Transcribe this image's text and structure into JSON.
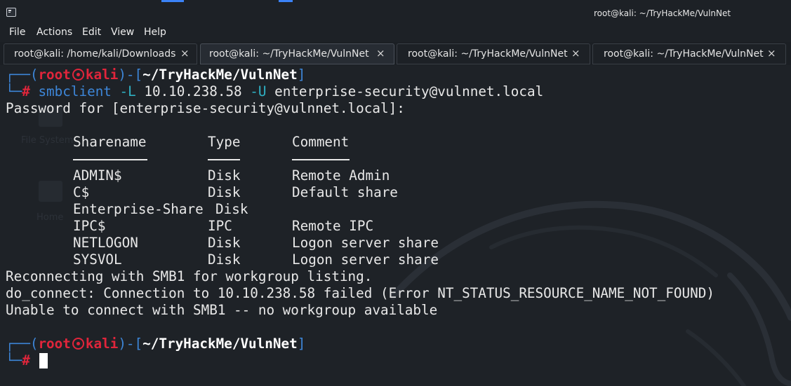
{
  "window": {
    "title": "root@kali: ~/TryHackMe/VulnNet",
    "app_icon": "terminal-icon"
  },
  "menu": {
    "items": [
      "File",
      "Actions",
      "Edit",
      "View",
      "Help"
    ]
  },
  "tabs": [
    {
      "label": "root@kali: /home/kali/Downloads",
      "close": "×",
      "active": false
    },
    {
      "label": "root@kali: ~/TryHackMe/VulnNet",
      "close": "×",
      "active": true
    },
    {
      "label": "root@kali: ~/TryHackMe/VulnNet",
      "close": "×",
      "active": false
    },
    {
      "label": "root@kali: ~/TryHackMe/VulnNet",
      "close": "×",
      "active": false
    }
  ],
  "desktop": {
    "ghost_labels": [
      "File System",
      "Home"
    ]
  },
  "terminal": {
    "prompt": {
      "corner_top": "┌──(",
      "user": "root",
      "host": "kali",
      "sep": ")-[",
      "cwd": "~/TryHackMe/VulnNet",
      "close": "]",
      "corner_bottom": "└─",
      "hash": "#"
    },
    "command": {
      "binary": "smbclient",
      "flag_l": "-L",
      "ip": "10.10.238.58",
      "flag_u": "-U",
      "user": "enterprise-security@vulnnet.local"
    },
    "password_prompt": "Password for [enterprise-security@vulnnet.local]:",
    "share_headers": {
      "name": "Sharename",
      "type": "Type",
      "comment": "Comment"
    },
    "shares": [
      {
        "name": "ADMIN$",
        "type": "Disk",
        "comment": "Remote Admin"
      },
      {
        "name": "C$",
        "type": "Disk",
        "comment": "Default share"
      },
      {
        "name": "Enterprise-Share",
        "type": "Disk",
        "comment": ""
      },
      {
        "name": "IPC$",
        "type": "IPC",
        "comment": "Remote IPC"
      },
      {
        "name": "NETLOGON",
        "type": "Disk",
        "comment": "Logon server share"
      },
      {
        "name": "SYSVOL",
        "type": "Disk",
        "comment": "Logon server share"
      }
    ],
    "messages": [
      "Reconnecting with SMB1 for workgroup listing.",
      "do_connect: Connection to 10.10.238.58 failed (Error NT_STATUS_RESOURCE_NAME_NOT_FOUND)",
      "Unable to connect with SMB1 -- no workgroup available"
    ]
  },
  "colors": {
    "prompt_blue": "#3d86d8",
    "prompt_red": "#e0253b",
    "background": "#1e2227",
    "text": "#e8e8e8"
  }
}
